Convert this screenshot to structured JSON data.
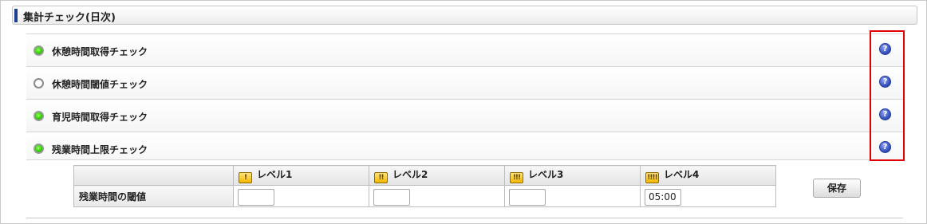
{
  "section": {
    "title": "集計チェック(日次)"
  },
  "checks": [
    {
      "label": "休憩時間取得チェック",
      "status": "on",
      "help": "?"
    },
    {
      "label": "休憩時間閾値チェック",
      "status": "off",
      "help": "?"
    },
    {
      "label": "育児時間取得チェック",
      "status": "on",
      "help": "?"
    },
    {
      "label": "残業時間上限チェック",
      "status": "on",
      "help": "?"
    }
  ],
  "threshold_table": {
    "row_label": "残業時間の閾値",
    "levels": [
      {
        "label": "レベル1",
        "icon": "!",
        "value": ""
      },
      {
        "label": "レベル2",
        "icon": "!!",
        "value": ""
      },
      {
        "label": "レベル3",
        "icon": "!!!",
        "value": ""
      },
      {
        "label": "レベル4",
        "icon": "!!!!",
        "value": "05:00"
      }
    ]
  },
  "save_label": "保存",
  "colors": {
    "accent": "#1f3f8f",
    "status_on": "#2fd400",
    "highlight": "#e00000",
    "help": "#2d48b4"
  }
}
